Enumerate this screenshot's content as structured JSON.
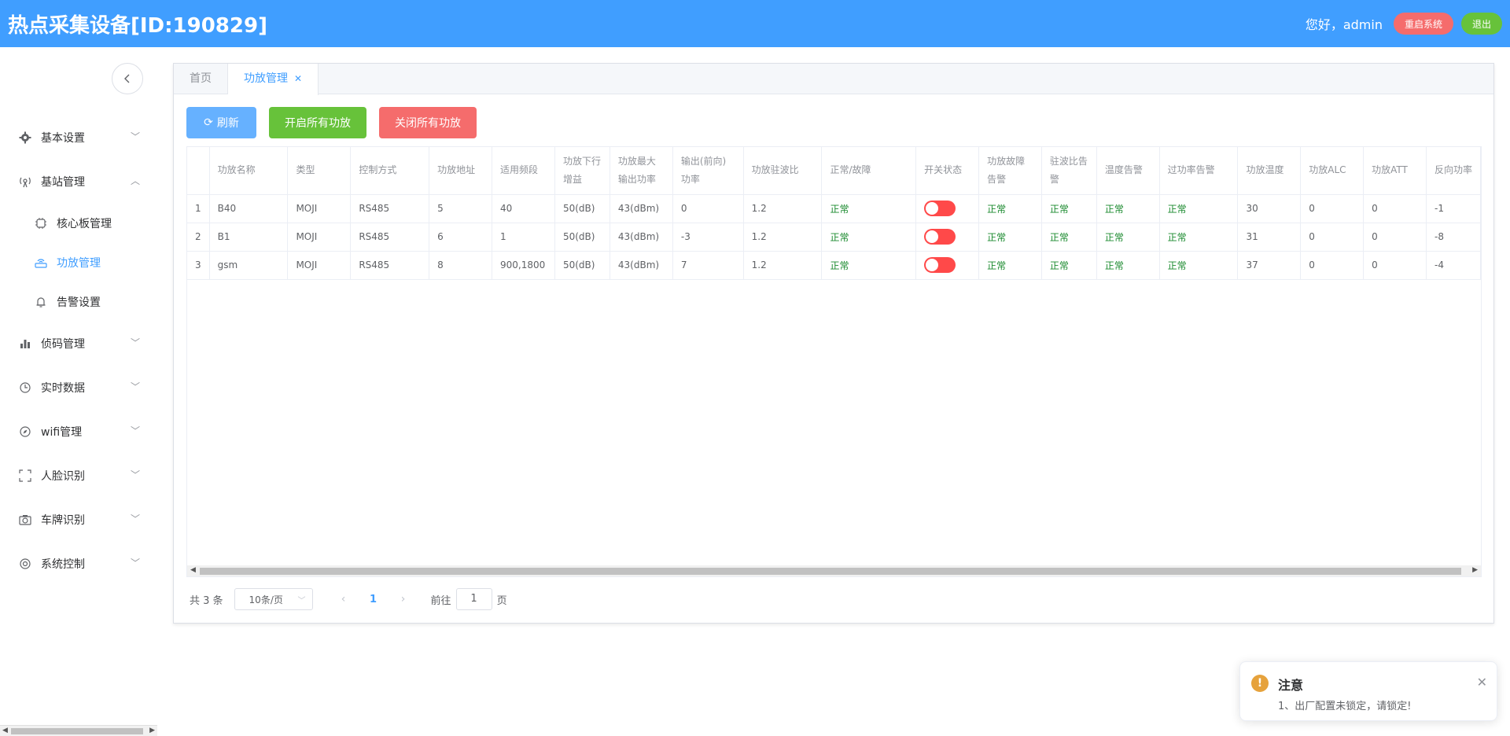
{
  "header": {
    "title": "热点采集设备[ID:190829]",
    "greeting": "您好，admin",
    "restart_label": "重启系统",
    "logout_label": "退出"
  },
  "sidebar": {
    "collapse_icon": "chevron-left-icon",
    "items": [
      {
        "label": "基本设置",
        "icon": "gear-icon"
      },
      {
        "label": "基站管理",
        "icon": "signal-icon",
        "expanded": true,
        "children": [
          {
            "label": "核心板管理",
            "icon": "chip-icon"
          },
          {
            "label": "功放管理",
            "icon": "router-icon",
            "active": true
          },
          {
            "label": "告警设置",
            "icon": "bell-icon"
          }
        ]
      },
      {
        "label": "侦码管理",
        "icon": "bar-chart-icon"
      },
      {
        "label": "实时数据",
        "icon": "clock-icon"
      },
      {
        "label": "wifi管理",
        "icon": "compass-icon"
      },
      {
        "label": "人脸识别",
        "icon": "scan-icon"
      },
      {
        "label": "车牌识别",
        "icon": "camera-icon"
      },
      {
        "label": "系统控制",
        "icon": "settings-icon"
      }
    ]
  },
  "tabs": [
    {
      "label": "首页",
      "active": false
    },
    {
      "label": "功放管理",
      "active": true
    }
  ],
  "toolbar": {
    "refresh_label": "刷新",
    "open_all_label": "开启所有功放",
    "close_all_label": "关闭所有功放"
  },
  "table": {
    "headers": [
      "",
      "功放名称",
      "类型",
      "控制方式",
      "功放地址",
      "适用频段",
      "功放下行增益",
      "功放最大输出功率",
      "输出(前向)功率",
      "功放驻波比",
      "正常/故障",
      "开关状态",
      "功放故障告警",
      "驻波比告警",
      "温度告警",
      "过功率告警",
      "功放温度",
      "功放ALC",
      "功放ATT",
      "反向功率"
    ],
    "rows": [
      [
        "1",
        "B40",
        "MOJI",
        "RS485",
        "5",
        "40",
        "50(dB)",
        "43(dBm)",
        "0",
        "1.2",
        "正常",
        "off",
        "正常",
        "正常",
        "正常",
        "正常",
        "30",
        "0",
        "0",
        "-1"
      ],
      [
        "2",
        "B1",
        "MOJI",
        "RS485",
        "6",
        "1",
        "50(dB)",
        "43(dBm)",
        "-3",
        "1.2",
        "正常",
        "off",
        "正常",
        "正常",
        "正常",
        "正常",
        "31",
        "0",
        "0",
        "-8"
      ],
      [
        "3",
        "gsm",
        "MOJI",
        "RS485",
        "8",
        "900,1800",
        "50(dB)",
        "43(dBm)",
        "7",
        "1.2",
        "正常",
        "off",
        "正常",
        "正常",
        "正常",
        "正常",
        "37",
        "0",
        "0",
        "-4"
      ]
    ]
  },
  "pager": {
    "total": "共 3 条",
    "page_size": "10条/页",
    "current": "1",
    "goto_label": "前往",
    "goto_value": "1",
    "page_suffix": "页"
  },
  "notification": {
    "title": "注意",
    "message": "1、出厂配置未锁定，请锁定!"
  },
  "colors": {
    "primary": "#409eff",
    "success": "#67c23a",
    "danger": "#f56c6c",
    "warning": "#e6a23c"
  }
}
